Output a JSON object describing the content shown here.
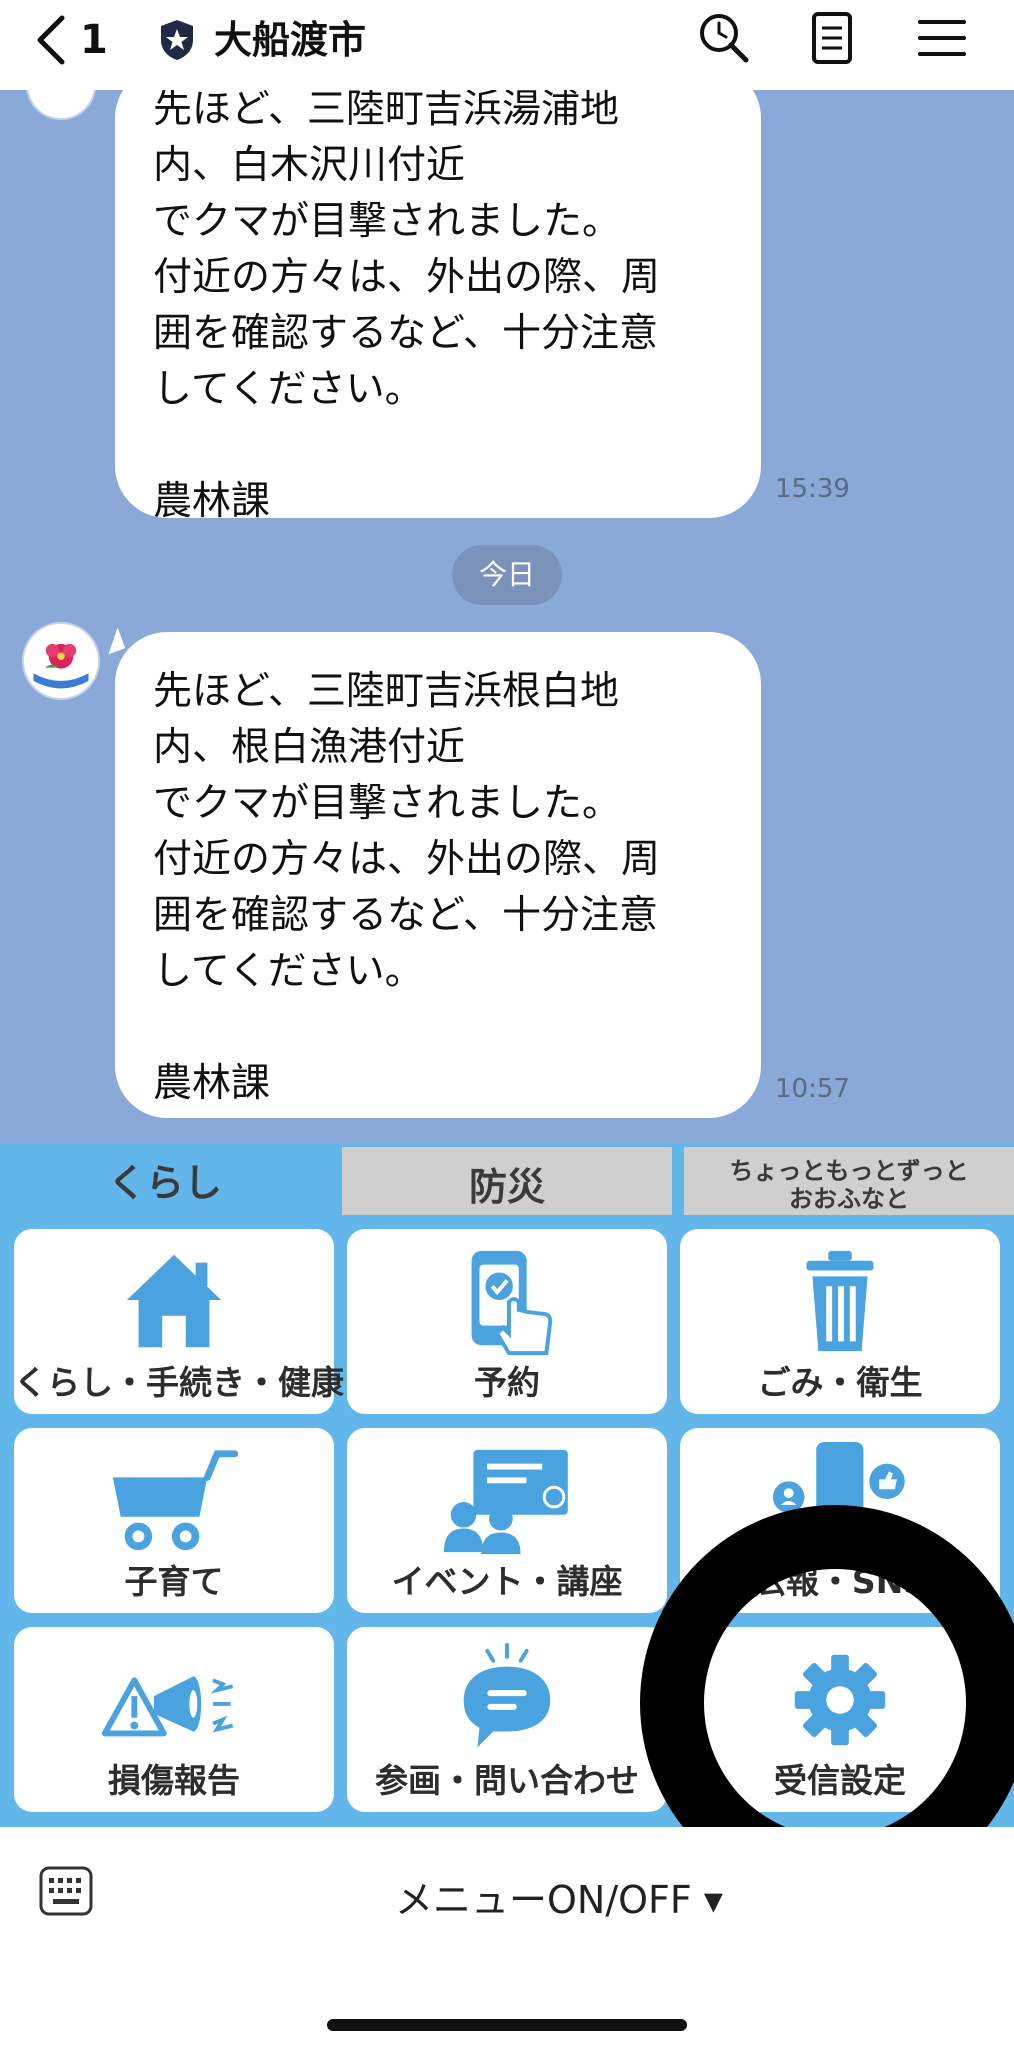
{
  "header": {
    "back_count": "1",
    "title": "大船渡市",
    "icons": [
      "search-icon",
      "notes-icon",
      "menu-icon"
    ]
  },
  "chat": {
    "messages": [
      {
        "lines": [
          "先ほど、三陸町吉浜湯浦地",
          "内、白木沢川付近",
          "でクマが目撃されました。",
          "付近の方々は、外出の際、周",
          "囲を確認するなど、十分注意",
          "してください。",
          "",
          "農林課"
        ],
        "time": "15:39"
      },
      {
        "lines": [
          "先ほど、三陸町吉浜根白地",
          "内、根白漁港付近",
          "でクマが目撃されました。",
          "付近の方々は、外出の際、周",
          "囲を確認するなど、十分注意",
          "してください。",
          "",
          "農林課"
        ],
        "time": "10:57"
      }
    ],
    "date_separator": "今日"
  },
  "rich_menu": {
    "tabs": [
      "くらし",
      "防災",
      "ちょっともっとずっと",
      "おおふなと"
    ],
    "tiles": [
      {
        "label": "くらし・手続き・健康",
        "icon": "house-icon"
      },
      {
        "label": "予約",
        "icon": "smartphone-tap-icon"
      },
      {
        "label": "ごみ・衛生",
        "icon": "trash-icon"
      },
      {
        "label": "子育て",
        "icon": "stroller-icon"
      },
      {
        "label": "イベント・講座",
        "icon": "presentation-icon"
      },
      {
        "label": "広報・SNS",
        "icon": "sns-icon"
      },
      {
        "label": "損傷報告",
        "icon": "megaphone-warning-icon"
      },
      {
        "label": "参画・問い合わせ",
        "icon": "speech-bubble-icon"
      },
      {
        "label": "受信設定",
        "icon": "gear-icon"
      }
    ]
  },
  "bottom_bar": {
    "menu_toggle": "メニューON/OFF ▾"
  },
  "colors": {
    "chat_background": "#8aa9d8",
    "menu_background": "#62b6ea",
    "icon_blue": "#4aa3df",
    "inactive_tab": "#cfcfcf"
  }
}
